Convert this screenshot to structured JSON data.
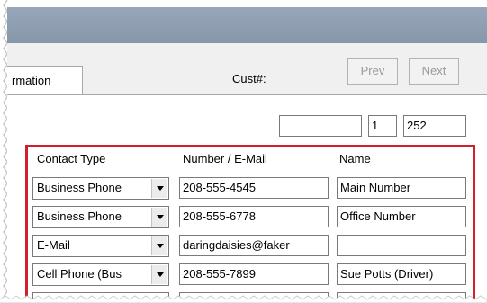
{
  "tab": {
    "label": "rmation"
  },
  "nav": {
    "prev_label": "Prev",
    "next_label": "Next"
  },
  "customer": {
    "label": "Cust#:",
    "field1": "",
    "field2": "1",
    "field3": "252"
  },
  "table": {
    "headers": {
      "type": "Contact Type",
      "number": "Number / E-Mail",
      "name": "Name"
    },
    "rows": [
      {
        "type": "Business Phone",
        "number": "208-555-4545",
        "name": "Main Number"
      },
      {
        "type": "Business Phone",
        "number": "208-555-6778",
        "name": "Office Number"
      },
      {
        "type": "E-Mail",
        "number": "daringdaisies@faker",
        "name": ""
      },
      {
        "type": "Cell Phone (Bus",
        "number": "208-555-7899",
        "name": "Sue Potts (Driver)"
      }
    ]
  },
  "colors": {
    "titlebar": "#8f9fb2",
    "highlight": "#d21f2e"
  }
}
